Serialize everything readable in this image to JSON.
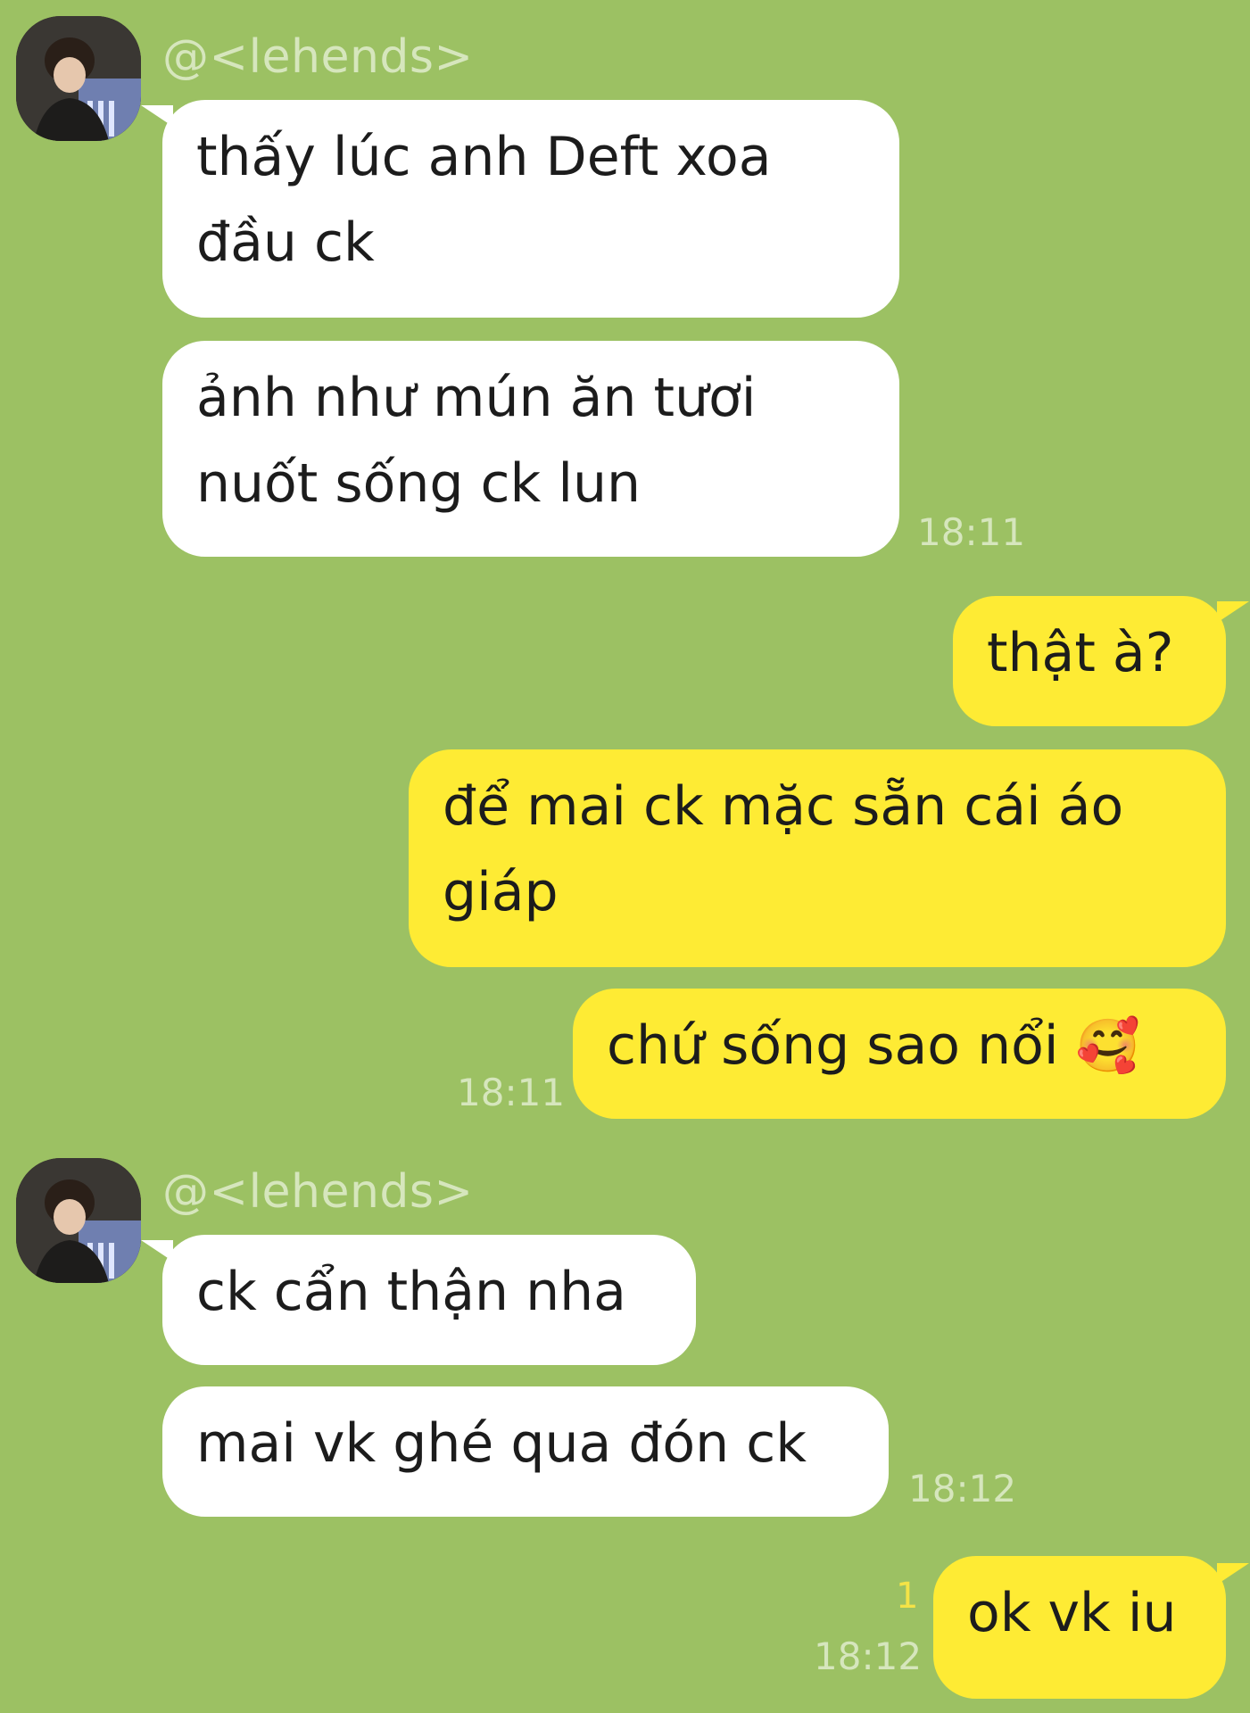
{
  "contact": {
    "name": "@<lehends>"
  },
  "messages": {
    "g1": {
      "m1": "thấy lúc anh Deft xoa đầu ck",
      "m2": "ảnh như mún ăn tươi nuốt sống ck lun",
      "time": "18:11"
    },
    "g2": {
      "m1": "thật à?",
      "m2": "để mai ck mặc sẵn cái áo giáp",
      "m3": "chứ sống sao nổi",
      "emoji": "🥰",
      "time": "18:11"
    },
    "g3": {
      "m1": "ck cẩn thận nha",
      "m2": "mai vk ghé qua đón ck",
      "time": "18:12"
    },
    "g4": {
      "m1": "ok vk iu",
      "time": "18:12",
      "read_count": "1"
    }
  },
  "colors": {
    "background": "#9cc163",
    "incoming": "#ffffff",
    "outgoing": "#feeb34"
  },
  "icons": {
    "avatar": "profile-photo",
    "emoji": "smiling-face-with-hearts"
  }
}
